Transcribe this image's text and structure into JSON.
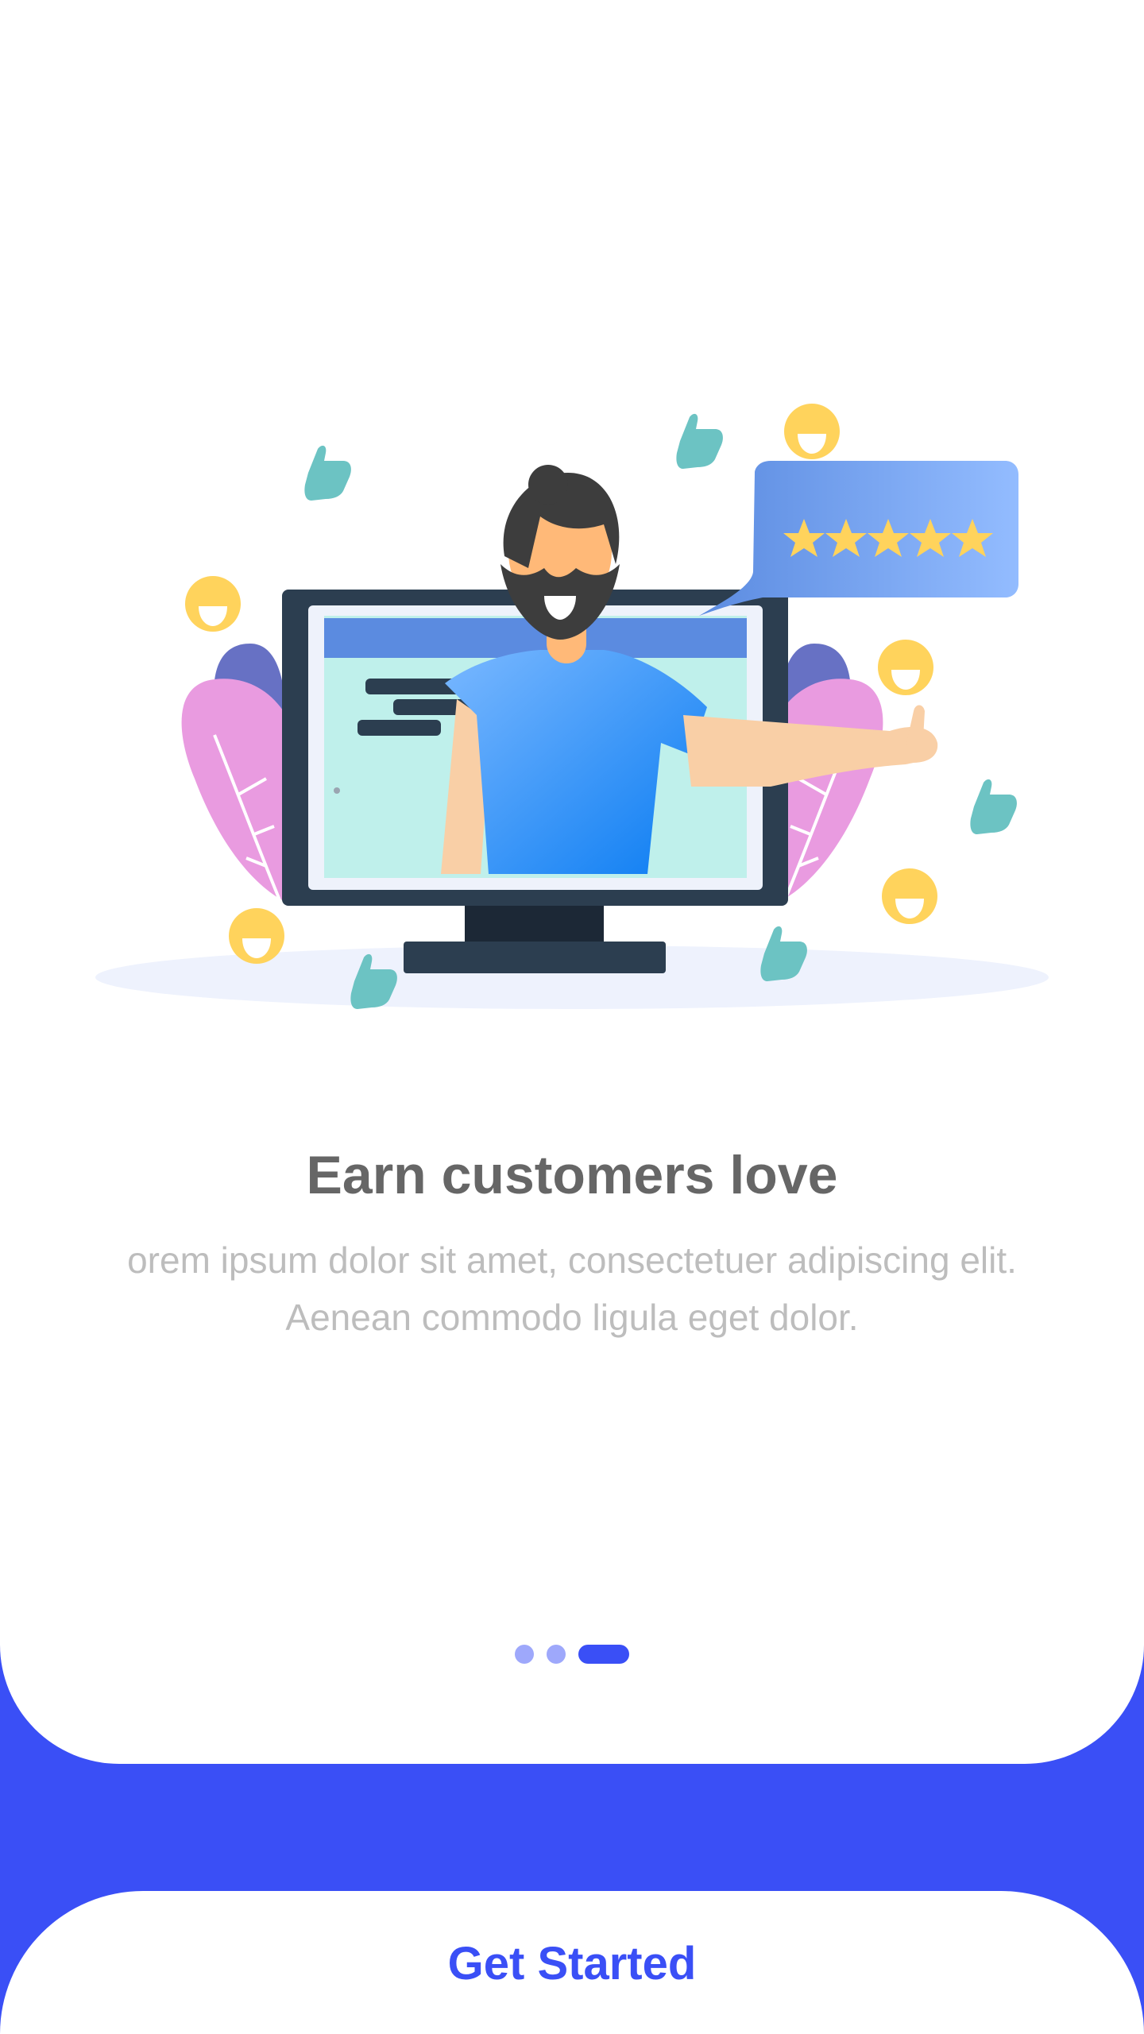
{
  "onboarding": {
    "title": "Earn customers love",
    "description": "orem ipsum dolor sit amet, consectetuer adipiscing elit. Aenean commodo ligula eget dolor.",
    "pager": {
      "total": 3,
      "active_index": 2
    },
    "illustration": {
      "subject": "man-waving-from-monitor",
      "rating_stars": 5,
      "icons": [
        "thumbs-up-icon",
        "smiley-icon",
        "star-icon"
      ]
    }
  },
  "cta": {
    "label": "Get Started"
  },
  "colors": {
    "accent": "#3a4ff6",
    "title": "#666666",
    "description": "#bdbdbd",
    "dot_inactive": "#9ea8fb",
    "star": "#ffd35c",
    "thumbs": "#6cc3c3",
    "leaf_pink": "#e99be0",
    "leaf_purple": "#6771c4"
  }
}
